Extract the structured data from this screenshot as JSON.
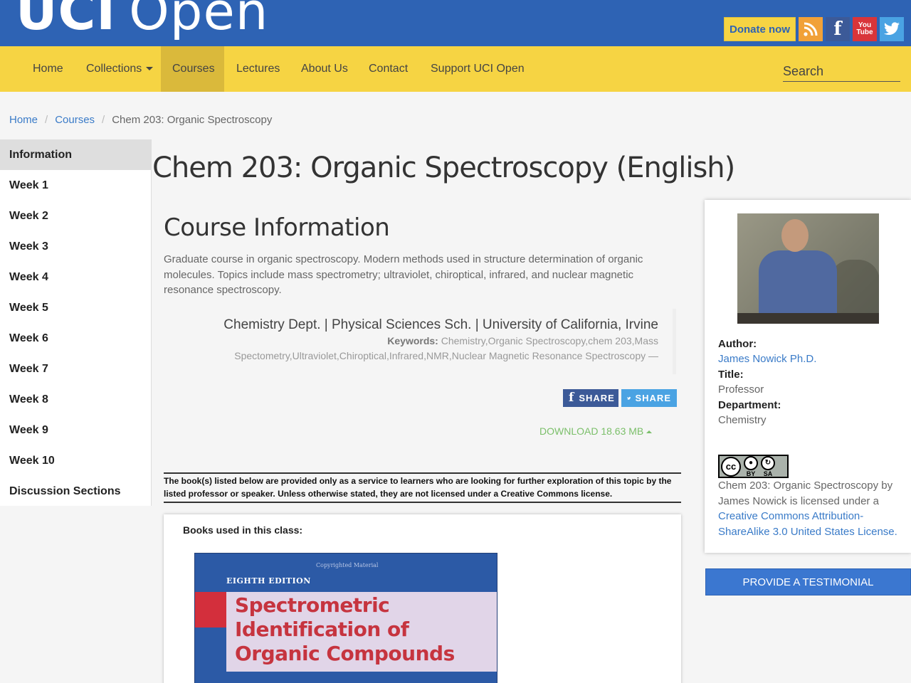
{
  "header": {
    "logo_uci": "UCI",
    "logo_open": "Open",
    "donate_label": "Donate now",
    "social": [
      "rss-icon",
      "facebook-icon",
      "youtube-icon",
      "twitter-icon"
    ],
    "youtube_text_top": "You",
    "youtube_text_bottom": "Tube"
  },
  "nav": {
    "items": [
      "Home",
      "Collections",
      "Courses",
      "Lectures",
      "About Us",
      "Contact",
      "Support UCI Open"
    ],
    "active": "Courses",
    "search_placeholder": "Search"
  },
  "breadcrumb": [
    "Home",
    "Courses",
    "Chem 203: Organic Spectroscopy"
  ],
  "sidebar": {
    "items": [
      "Information",
      "Week 1",
      "Week 2",
      "Week 3",
      "Week 4",
      "Week 5",
      "Week 6",
      "Week 7",
      "Week 8",
      "Week 9",
      "Week 10",
      "Discussion Sections"
    ],
    "active": "Information"
  },
  "main": {
    "course_title": "Chem 203: Organic Spectroscopy (English)",
    "section_title": "Course Information",
    "description": "Graduate course in organic spectroscopy. Modern methods used in structure determination of organic molecules. Topics include mass spectrometry; ultraviolet, chiroptical, infrared, and nuclear magnetic resonance spectroscopy.",
    "department_line": "Chemistry Dept. | Physical Sciences Sch. | University of California, Irvine",
    "keywords_label": "Keywords:",
    "keywords": "Chemistry,Organic Spectroscopy,chem 203,Mass Spectometry,Ultraviolet,Chiroptical,Infrared,NMR,Nuclear Magnetic Resonance Spectroscopy —",
    "share_fb": "SHARE",
    "share_tw": "SHARE",
    "download_label": "DOWNLOAD 18.63 MB",
    "notice": "The book(s) listed below are provided only as a service to learners who are looking for further exploration of this topic by the listed professor or speaker. Unless otherwise stated, they are not licensed under a Creative Commons license.",
    "books_label": "Books used in this class:",
    "book_copyright": "Copyrighted Material",
    "book_edition": "EIGHTH EDITION",
    "book_title_line1": "Spectrometric",
    "book_title_line2": "Identification of",
    "book_title_line3": "Organic Compounds"
  },
  "author_card": {
    "author_label": "Author:",
    "author_name": "James Nowick Ph.D.",
    "title_label": "Title:",
    "title_value": "Professor",
    "department_label": "Department:",
    "department_value": "Chemistry",
    "cc_text": "cc",
    "cc_by": "BY",
    "cc_sa": "SA",
    "license_text": "Chem 203: Organic Spectroscopy by James Nowick is licensed under a ",
    "license_link": "Creative Commons Attribution-ShareAlike 3.0 United States License."
  },
  "testimonial_label": "PROVIDE A TESTIMONIAL",
  "colors": {
    "header_blue": "#2e63b4",
    "nav_yellow": "#f6d443",
    "link_blue": "#3a7bc8",
    "download_green": "#7bbf6a"
  }
}
